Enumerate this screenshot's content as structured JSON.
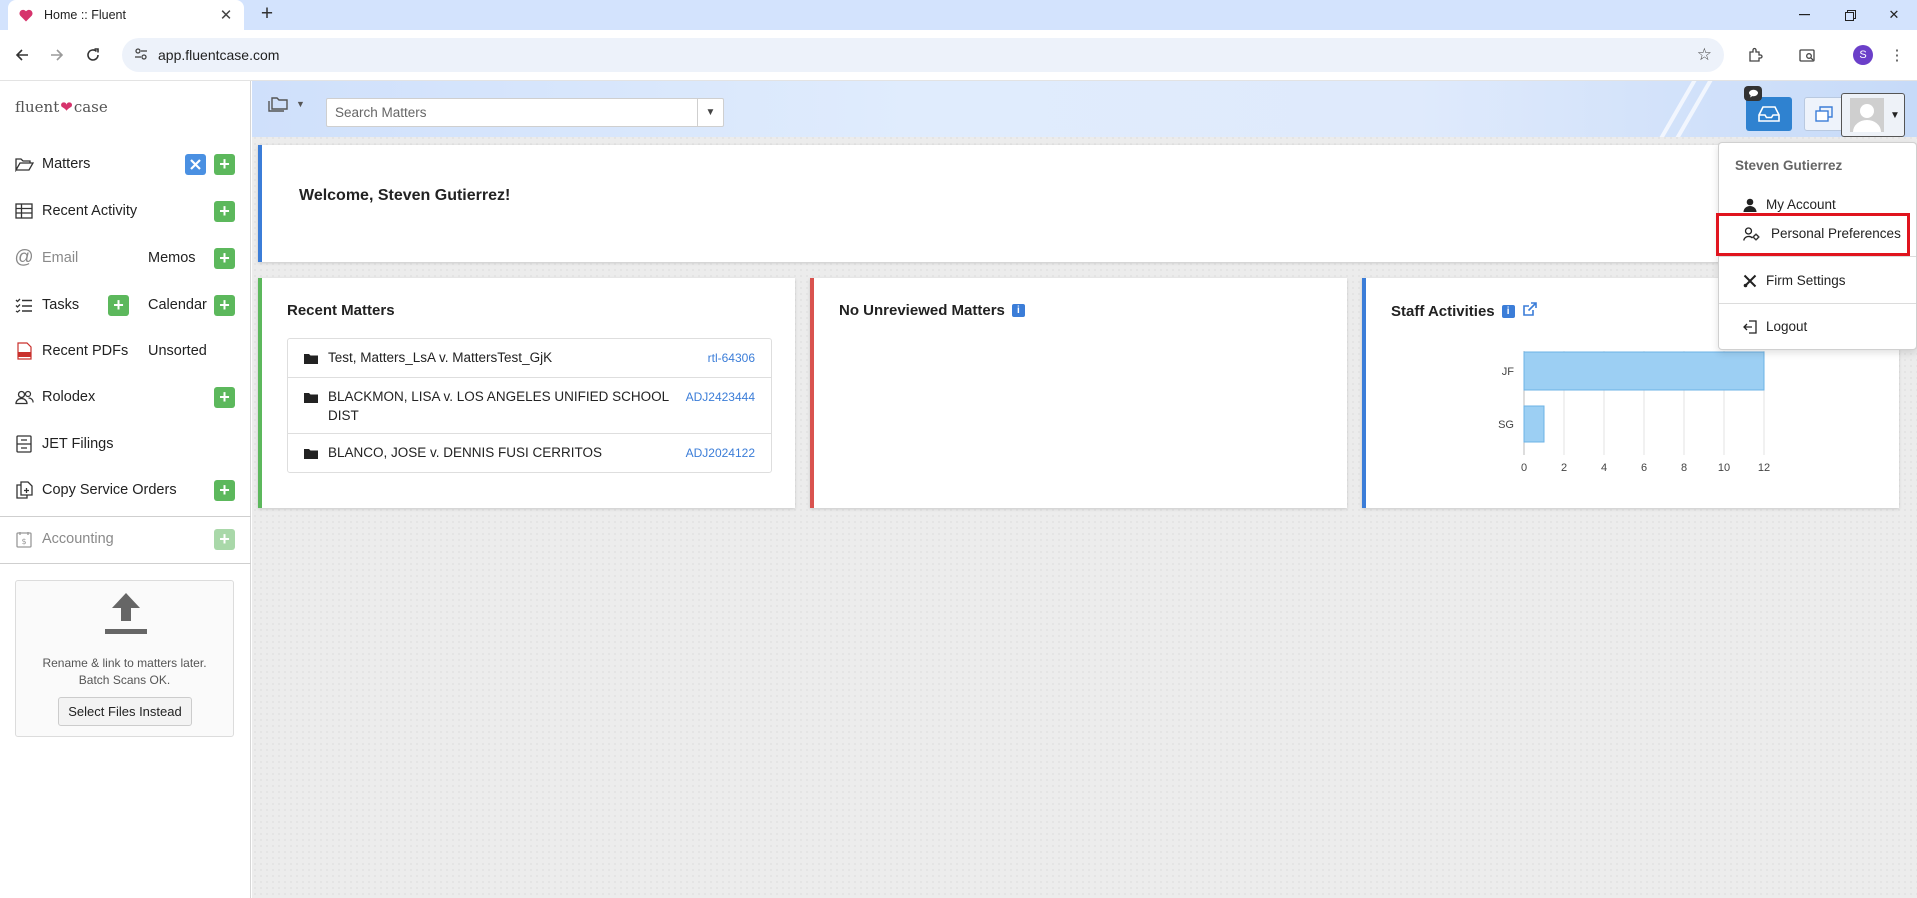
{
  "browser": {
    "tab_title": "Home :: Fluent",
    "url": "app.fluentcase.com",
    "profile_initial": "S"
  },
  "sidebar": {
    "logo_left": "fluent",
    "logo_right": "case",
    "items": [
      {
        "label": "Matters"
      },
      {
        "label": "Recent Activity"
      },
      {
        "label": "Email",
        "sub": "Memos"
      },
      {
        "label": "Tasks",
        "sub": "Calendar"
      },
      {
        "label": "Recent PDFs",
        "sub": "Unsorted"
      },
      {
        "label": "Rolodex"
      },
      {
        "label": "JET Filings"
      },
      {
        "label": "Copy Service Orders"
      },
      {
        "label": "Accounting"
      }
    ],
    "upload": {
      "hint_line1": "Rename & link to matters later.",
      "hint_line2": "Batch Scans OK.",
      "button": "Select Files Instead"
    }
  },
  "header": {
    "search_placeholder": "Search Matters"
  },
  "welcome": "Welcome, Steven Gutierrez!",
  "recent_matters": {
    "title": "Recent Matters",
    "rows": [
      {
        "name": "Test, Matters_LsA v. MattersTest_GjK",
        "code": "rtl-64306"
      },
      {
        "name": "BLACKMON, LISA v. LOS ANGELES UNIFIED SCHOOL DIST",
        "code": "ADJ2423444"
      },
      {
        "name": "BLANCO, JOSE v. DENNIS FUSI CERRITOS",
        "code": "ADJ2024122"
      }
    ]
  },
  "unreviewed": {
    "title": "No Unreviewed Matters"
  },
  "staff": {
    "title": "Staff Activities"
  },
  "chart_data": {
    "type": "bar",
    "orientation": "horizontal",
    "categories": [
      "JF",
      "SG"
    ],
    "values": [
      12,
      1
    ],
    "xlim": [
      0,
      12
    ],
    "xticks": [
      0,
      2,
      4,
      6,
      8,
      10,
      12
    ],
    "grid": true,
    "bar_color": "#9ccff3",
    "title": "Staff Activities"
  },
  "user_menu": {
    "user": "Steven Gutierrez",
    "items": [
      "My Account",
      "Personal Preferences",
      "Firm Settings",
      "Logout"
    ]
  },
  "colors": {
    "accent_blue": "#3b7dd8",
    "add_green": "#5cb85c",
    "highlight_red": "#e0141e"
  }
}
